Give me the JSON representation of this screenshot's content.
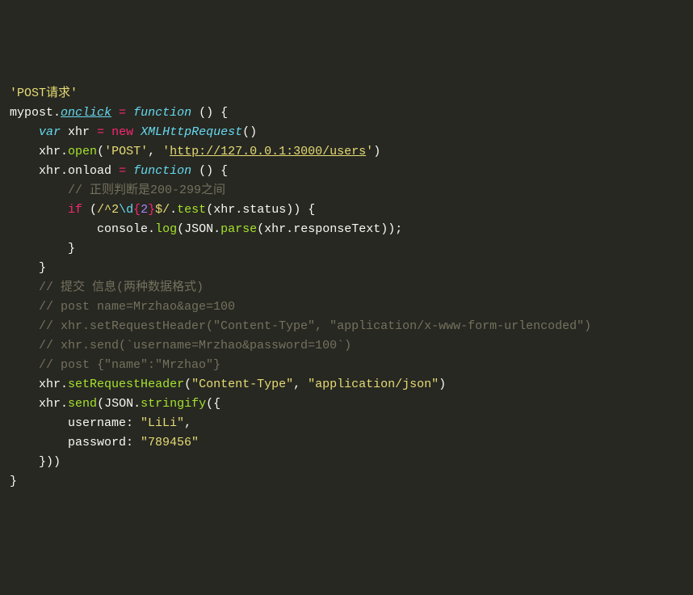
{
  "code": {
    "line1_string": "'POST请求'",
    "line2_mypost": "mypost",
    "line2_onclick": "onclick",
    "line2_eq": " = ",
    "line2_function": "function",
    "line2_parens": " () ",
    "line2_brace": "{",
    "line3_indent": "    ",
    "line3_var": "var",
    "line3_xhr": " xhr ",
    "line3_eq": "=",
    "line3_new": " new",
    "line3_class": " XMLHttpRequest",
    "line3_call": "()",
    "line4_indent": "    ",
    "line4_xhr": "xhr",
    "line4_dot": ".",
    "line4_open": "open",
    "line4_paren1": "(",
    "line4_post": "'POST'",
    "line4_comma": ", ",
    "line4_q1": "'",
    "line4_url": "http://127.0.0.1:3000/users",
    "line4_q2": "'",
    "line4_paren2": ")",
    "line5_indent": "    ",
    "line5_xhr": "xhr",
    "line5_dot": ".",
    "line5_onload": "onload",
    "line5_eq": " = ",
    "line5_function": "function",
    "line5_parens": " () ",
    "line5_brace": "{",
    "line6": "        // 正则判断是200-299之间",
    "line7_indent": "        ",
    "line7_if": "if",
    "line7_sp": " (",
    "line7_regex1": "/^",
    "line7_regex2": "2",
    "line7_regex3": "\\d",
    "line7_regex4": "{",
    "line7_regex5": "2",
    "line7_regex6": "}",
    "line7_regex7": "$/",
    "line7_dot": ".",
    "line7_test": "test",
    "line7_p1": "(",
    "line7_xhr": "xhr",
    "line7_dot2": ".",
    "line7_status": "status",
    "line7_p2": "))",
    "line7_sp2": " ",
    "line7_brace": "{",
    "line8_indent": "            ",
    "line8_console": "console",
    "line8_dot": ".",
    "line8_log": "log",
    "line8_p1": "(",
    "line8_json": "JSON",
    "line8_dot2": ".",
    "line8_parse": "parse",
    "line8_p2": "(",
    "line8_xhr": "xhr",
    "line8_dot3": ".",
    "line8_resp": "responseText",
    "line8_p3": "));",
    "line9": "        }",
    "line10": "    }",
    "line11": "    // 提交 信息(两种数据格式)",
    "line12": "    // post name=Mrzhao&age=100",
    "line13": "    // xhr.setRequestHeader(\"Content-Type\", \"application/x-www-form-urlencoded\")",
    "line14": "    // xhr.send(`username=Mrzhao&password=100`)",
    "line15": "",
    "line16": "    // post {\"name\":\"Mrzhao\"}",
    "line17_indent": "    ",
    "line17_xhr": "xhr",
    "line17_dot": ".",
    "line17_method": "setRequestHeader",
    "line17_p1": "(",
    "line17_s1": "\"Content-Type\"",
    "line17_comma": ", ",
    "line17_s2": "\"application/json\"",
    "line17_p2": ")",
    "line18_indent": "    ",
    "line18_xhr": "xhr",
    "line18_dot": ".",
    "line18_send": "send",
    "line18_p1": "(",
    "line18_json": "JSON",
    "line18_dot2": ".",
    "line18_stringify": "stringify",
    "line18_p2": "(",
    "line18_brace": "{",
    "line19_indent": "        ",
    "line19_key": "username",
    "line19_colon": ": ",
    "line19_val": "\"LiLi\"",
    "line19_comma": ",",
    "line20_indent": "        ",
    "line20_key": "password",
    "line20_colon": ": ",
    "line20_val": "\"789456\"",
    "line21": "    }))",
    "line22": "}"
  }
}
